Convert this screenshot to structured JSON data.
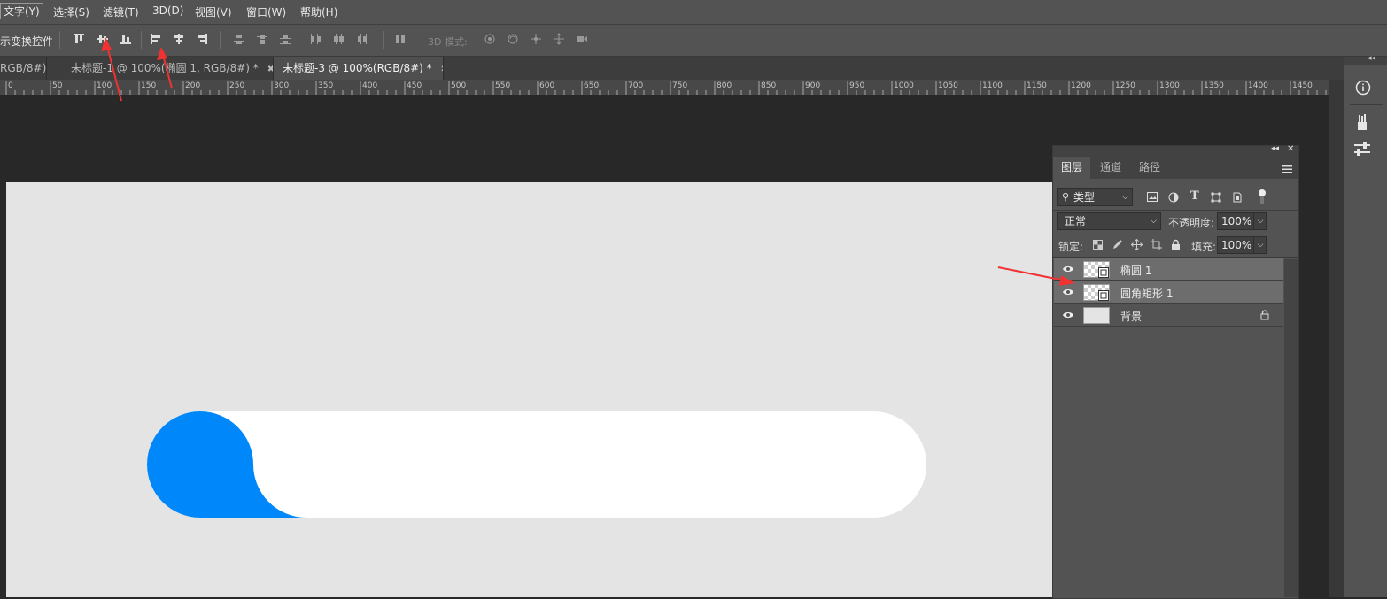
{
  "menu": {
    "items": [
      "文字(Y)",
      "选择(S)",
      "滤镜(T)",
      "3D(D)",
      "视图(V)",
      "窗口(W)",
      "帮助(H)"
    ]
  },
  "options": {
    "transform_label": "示变换控件",
    "mode_3d_label": "3D 模式:"
  },
  "tabs": [
    {
      "label": "RGB/8#)"
    },
    {
      "label": "未标题-1 @ 100%(椭圆 1, RGB/8#) *"
    },
    {
      "label": "未标题-3 @ 100%(RGB/8#) *"
    }
  ],
  "ruler": {
    "labels": [
      "0",
      "50",
      "100",
      "150",
      "200",
      "250",
      "300",
      "350",
      "400",
      "450",
      "500",
      "550",
      "600",
      "650",
      "700",
      "750",
      "800",
      "850",
      "900",
      "950",
      "1000",
      "1050",
      "1100",
      "1150",
      "1200",
      "1250",
      "1300",
      "1350",
      "1400",
      "1450"
    ]
  },
  "layers_panel": {
    "tabs": [
      "图层",
      "通道",
      "路径"
    ],
    "filter_kind": "类型",
    "blend_mode": "正常",
    "opacity_label": "不透明度:",
    "opacity_value": "100%",
    "lock_label": "锁定:",
    "fill_label": "填充:",
    "fill_value": "100%",
    "layers": [
      {
        "name": "椭圆 1",
        "selected": true
      },
      {
        "name": "圆角矩形 1",
        "selected": true
      },
      {
        "name": "背景",
        "selected": false,
        "locked": true
      }
    ]
  },
  "colors": {
    "accent_blue": "#0088fb",
    "canvas_bg": "#e4e4e4",
    "annotation_red": "#f03232"
  }
}
